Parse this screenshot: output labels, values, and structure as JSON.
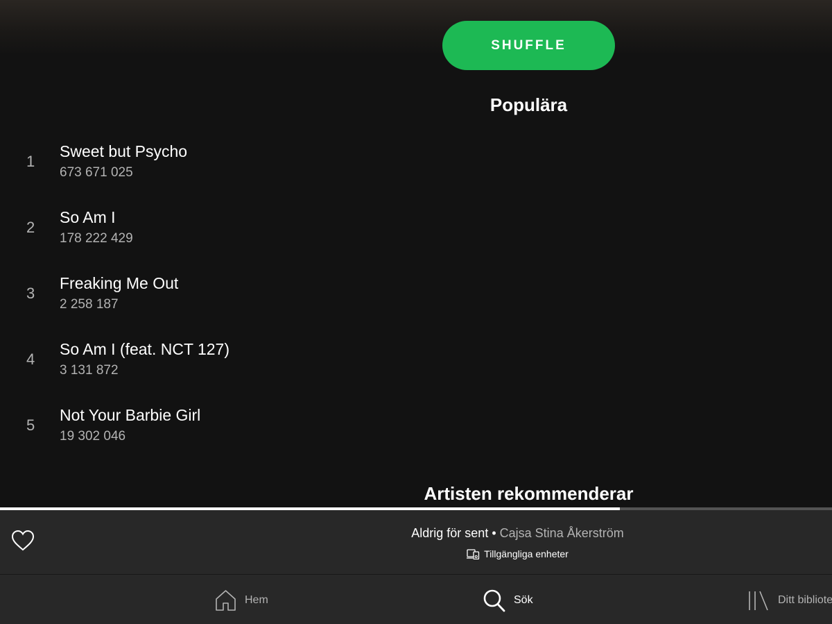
{
  "header": {
    "shuffle_label": "SHUFFLE"
  },
  "popular": {
    "title": "Populära",
    "tracks": [
      {
        "number": "1",
        "title": "Sweet but Psycho",
        "plays": "673 671 025"
      },
      {
        "number": "2",
        "title": "So Am I",
        "plays": "178 222 429"
      },
      {
        "number": "3",
        "title": "Freaking Me Out",
        "plays": "2 258 187"
      },
      {
        "number": "4",
        "title": "So Am I (feat. NCT 127)",
        "plays": "3 131 872"
      },
      {
        "number": "5",
        "title": "Not Your Barbie Girl",
        "plays": "19 302 046"
      }
    ]
  },
  "recommend": {
    "title": "Artisten rekommenderar"
  },
  "player": {
    "progress_fraction": 0.745,
    "track_title": "Aldrig för sent",
    "separator": "•",
    "artist": "Cajsa Stina Åkerström",
    "devices_label": "Tillgängliga enheter",
    "heart_icon": "heart-outline-icon"
  },
  "tabs": [
    {
      "label": "Hem",
      "icon": "home-icon",
      "active": false
    },
    {
      "label": "Sök",
      "icon": "search-icon",
      "active": true
    },
    {
      "label": "Ditt bibliotek",
      "icon": "library-icon",
      "active": false
    }
  ],
  "colors": {
    "background": "#121212",
    "accent": "#1db954",
    "bar": "#282828",
    "secondary_text": "#b3b3b3"
  }
}
